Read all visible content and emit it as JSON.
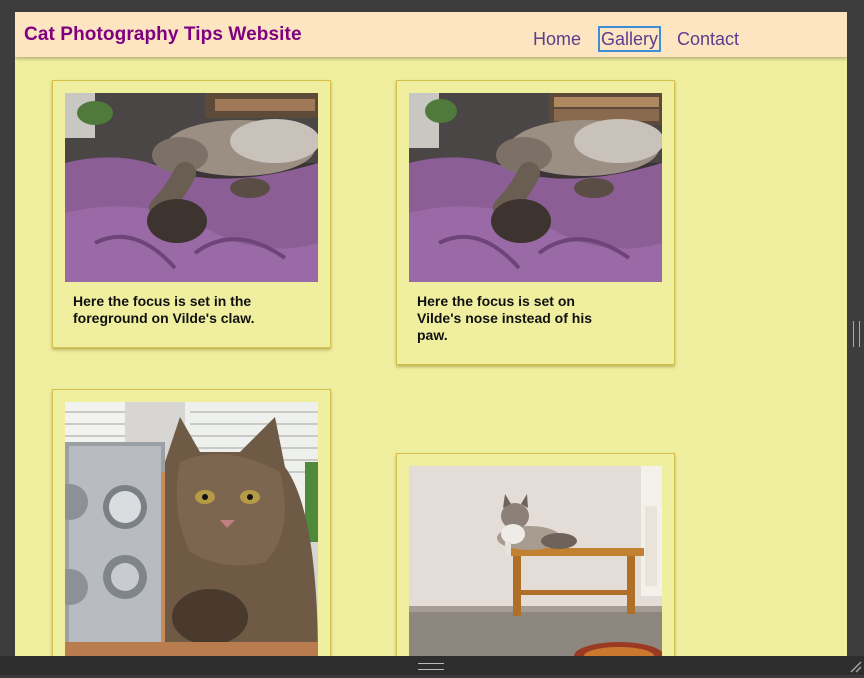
{
  "site": {
    "title": "Cat Photography Tips Website",
    "nav": [
      {
        "label": "Home",
        "active": false
      },
      {
        "label": "Gallery",
        "active": true
      },
      {
        "label": "Contact",
        "active": false
      }
    ]
  },
  "gallery": [
    {
      "caption": "Here the focus is set in the foreground on Vilde's claw.",
      "photo": "sleeping-cat-on-purple-blanket-photo"
    },
    {
      "caption": "Here the focus is set on Vilde's nose instead of his paw.",
      "photo": "sleeping-cat-on-purple-blanket-photo"
    },
    {
      "caption": "",
      "photo": "tabby-cat-beside-radio-photo"
    },
    {
      "caption": "",
      "photo": "cat-on-wooden-bench-photo"
    }
  ],
  "colors": {
    "page_background": "#efef9f",
    "header_background": "#fde5c2",
    "title": "#800080",
    "nav_link": "#5b3d8c",
    "active_outline": "#3b8fd6",
    "card_border": "#d6c04a"
  }
}
